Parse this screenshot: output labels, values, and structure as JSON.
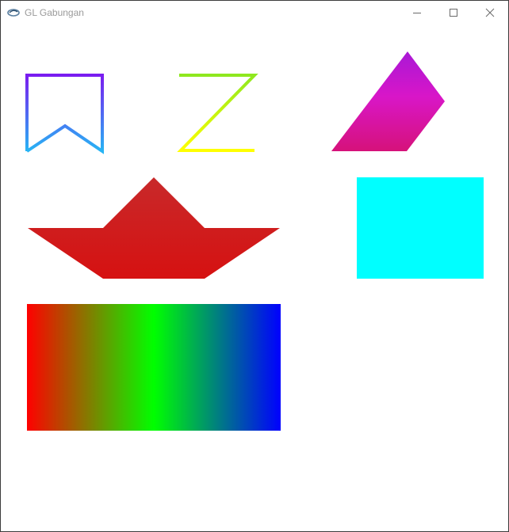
{
  "window": {
    "title": "GL Gabungan",
    "controls": {
      "minimize_icon": "minimize-icon",
      "maximize_icon": "maximize-icon",
      "close_icon": "close-icon"
    }
  },
  "scene": {
    "background": "#ffffff",
    "shapes": [
      {
        "name": "bookmark-outline",
        "colors": [
          "#7a1cf0",
          "#27b4f4"
        ]
      },
      {
        "name": "letter-z-outline",
        "colors": [
          "#8ee81f",
          "#ffff00"
        ]
      },
      {
        "name": "parallelogram-magenta",
        "colors": [
          "#a918d6",
          "#d816c8",
          "#d6127a"
        ]
      },
      {
        "name": "boat-red",
        "colors": [
          "#c8292a",
          "#d61111"
        ]
      },
      {
        "name": "rectangle-cyan",
        "colors": [
          "#00ffff"
        ]
      },
      {
        "name": "rectangle-rgb-gradient",
        "colors": [
          "#ff0000",
          "#00ff00",
          "#0000ff"
        ]
      }
    ]
  }
}
